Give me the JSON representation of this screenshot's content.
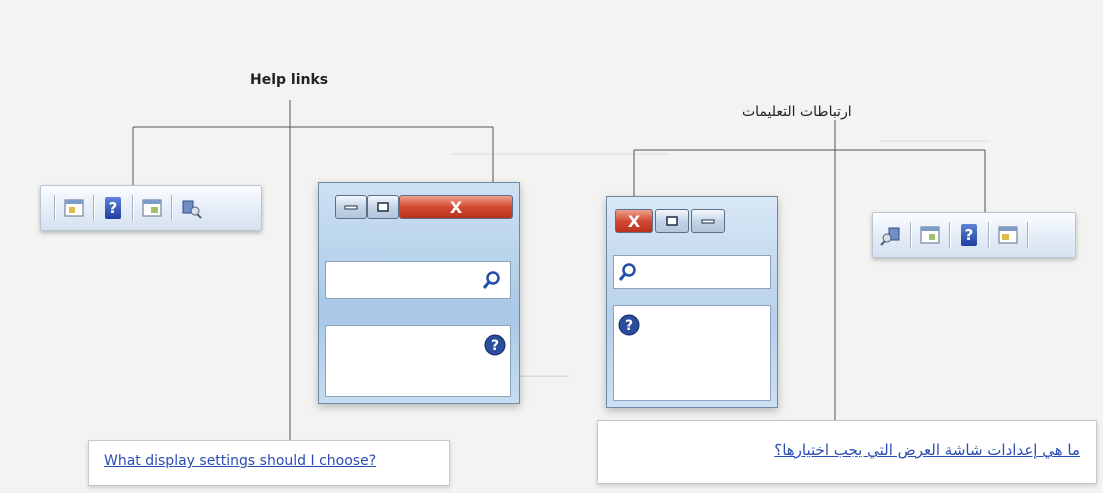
{
  "left": {
    "callout_label": "Help links",
    "link_text": "What display settings should I choose?",
    "window_close_glyph": "X"
  },
  "right": {
    "callout_label": "ارتباطات التعليمات",
    "link_text": "ما هي إعدادات شاشة العرض التي يجب اختيارها؟",
    "window_close_glyph": "X"
  },
  "icons": {
    "toolbar_left": [
      "window-icon",
      "help-icon",
      "window-icon",
      "tools-icon"
    ],
    "toolbar_right": [
      "tools-icon",
      "window-icon",
      "help-icon",
      "window-icon"
    ],
    "search": "search-icon",
    "help_circle": "help-circle-icon"
  },
  "colors": {
    "link": "#2a4db5",
    "callout_line": "#555555",
    "close_button": "#d24a33",
    "help_icon": "#1f3f9c"
  }
}
